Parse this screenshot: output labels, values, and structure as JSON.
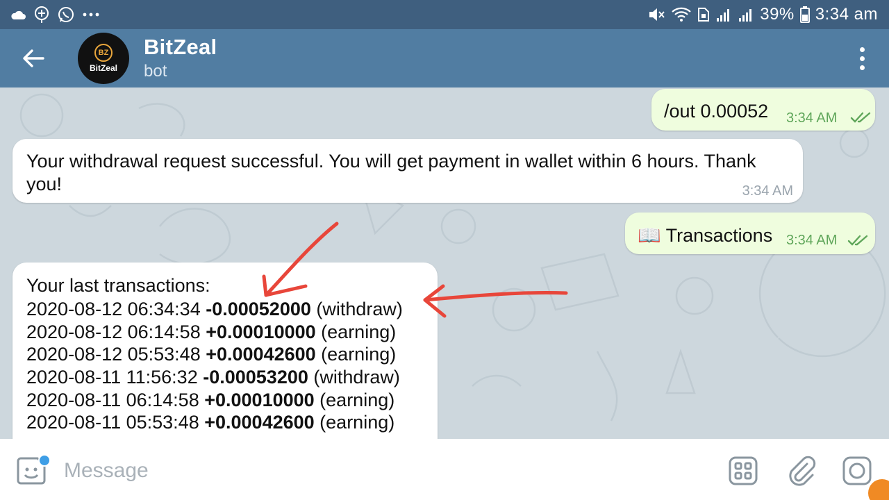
{
  "status_bar": {
    "battery": "39%",
    "time": "3:34 am"
  },
  "header": {
    "title": "BitZeal",
    "subtitle": "bot",
    "avatar_text": "BitZeal",
    "avatar_logo": "BZ"
  },
  "messages": {
    "m1": {
      "text": "/out 0.00052",
      "time": "3:34 AM"
    },
    "m2": {
      "text": "Your withdrawal request successful. You will get payment in wallet within 6 hours. Thank you!",
      "time": "3:34 AM"
    },
    "m3": {
      "icon": "📖",
      "text": "Transactions",
      "time": "3:34 AM"
    },
    "m4": {
      "heading": "Your last transactions:",
      "transactions": [
        {
          "datetime": "2020-08-12 06:34:34",
          "amount": "-0.00052000",
          "type": "(withdraw)"
        },
        {
          "datetime": "2020-08-12 06:14:58",
          "amount": "+0.00010000",
          "type": "(earning)"
        },
        {
          "datetime": "2020-08-12 05:53:48",
          "amount": "+0.00042600",
          "type": "(earning)"
        },
        {
          "datetime": "2020-08-11 11:56:32",
          "amount": "-0.00053200",
          "type": "(withdraw)"
        },
        {
          "datetime": "2020-08-11 06:14:58",
          "amount": "+0.00010000",
          "type": "(earning)"
        },
        {
          "datetime": "2020-08-11 05:53:48",
          "amount": "+0.00042600",
          "type": "(earning)"
        }
      ]
    }
  },
  "input": {
    "placeholder": "Message"
  },
  "colors": {
    "header_bg": "#517da2",
    "status_bg": "#3f5f7f",
    "outgoing_bubble": "#effdde",
    "incoming_bubble": "#ffffff",
    "time_green": "#5fa65a",
    "annotation_red": "#e8463a"
  },
  "icons": {
    "back": "arrow-left-icon",
    "menu": "more-vertical-icon",
    "emoji": "sticker-icon",
    "commands": "bot-commands-icon",
    "attach": "paperclip-icon",
    "camera": "camera-icon",
    "read": "double-check-icon"
  }
}
